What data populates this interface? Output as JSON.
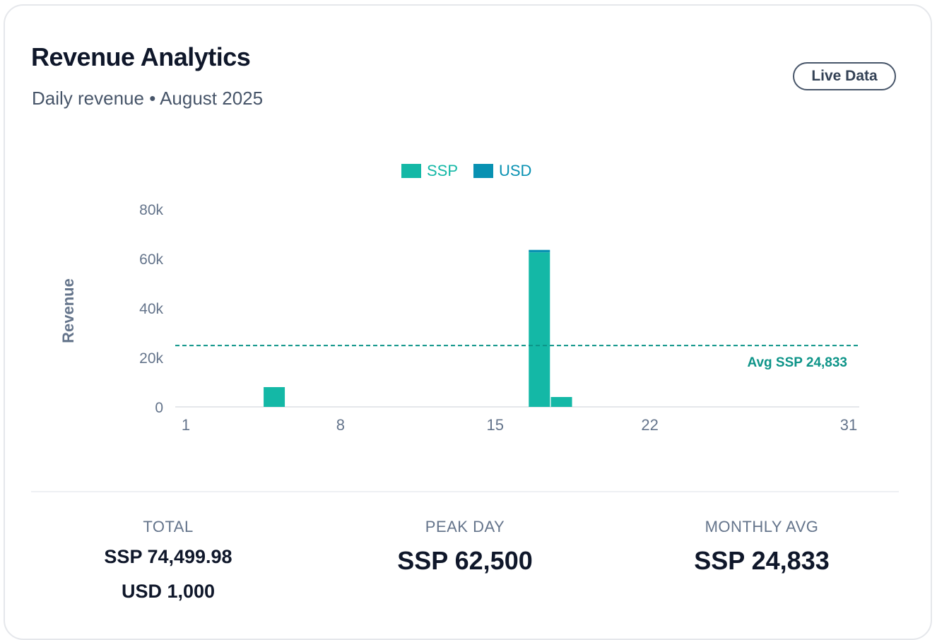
{
  "header": {
    "title": "Revenue Analytics",
    "subtitle": "Daily revenue • August 2025",
    "badge": "Live Data"
  },
  "colors": {
    "ssp": "#14b8a6",
    "usd": "#0891b2",
    "avg_line": "#0d9488",
    "axis_text": "#64748b"
  },
  "chart_data": {
    "type": "bar",
    "stacked": true,
    "ylabel": "Revenue",
    "xlim": [
      1,
      31
    ],
    "ylim": [
      0,
      80000
    ],
    "x_ticks": [
      1,
      8,
      15,
      22,
      31
    ],
    "y_ticks": [
      0,
      20000,
      40000,
      60000,
      80000
    ],
    "y_tick_labels": [
      "0",
      "20k",
      "40k",
      "60k",
      "80k"
    ],
    "legend_position": "top-center",
    "series": [
      {
        "name": "SSP",
        "color": "#14b8a6",
        "points": [
          {
            "x": 5,
            "y": 8000
          },
          {
            "x": 17,
            "y": 62500
          },
          {
            "x": 18,
            "y": 4000
          }
        ]
      },
      {
        "name": "USD",
        "color": "#0891b2",
        "points": [
          {
            "x": 17,
            "y": 1000
          }
        ]
      }
    ],
    "reference_line": {
      "label": "Avg SSP 24,833",
      "value": 24833
    }
  },
  "stats": {
    "total_label": "TOTAL",
    "total_ssp": "SSP 74,499.98",
    "total_usd": "USD 1,000",
    "peak_label": "PEAK DAY",
    "peak_value": "SSP 62,500",
    "avg_label": "MONTHLY AVG",
    "avg_value": "SSP 24,833"
  }
}
